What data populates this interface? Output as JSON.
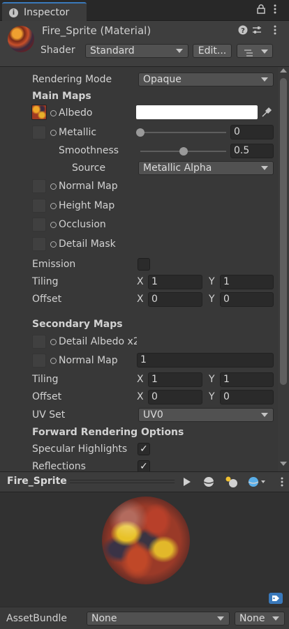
{
  "tab": {
    "label": "Inspector",
    "info_icon": "info-icon",
    "lock_icon": "lock-icon",
    "menu_icon": "kebab-menu-icon"
  },
  "header": {
    "title": "Fire_Sprite (Material)",
    "shader_label": "Shader",
    "shader_value": "Standard",
    "edit_label": "Edit...",
    "icons": [
      "help-icon",
      "settings-sliders-icon",
      "kebab-menu-icon",
      "list-icon"
    ]
  },
  "props": {
    "rendering_mode_label": "Rendering Mode",
    "rendering_mode_value": "Opaque",
    "main_maps": "Main Maps",
    "albedo": "Albedo",
    "metallic": "Metallic",
    "metallic_value": "0",
    "metallic_level": 0,
    "smoothness": "Smoothness",
    "smoothness_value": "0.5",
    "smoothness_level": 0.5,
    "source_label": "Source",
    "source_value": "Metallic Alpha",
    "normal_map": "Normal Map",
    "height_map": "Height Map",
    "occlusion": "Occlusion",
    "detail_mask": "Detail Mask",
    "emission": "Emission",
    "tiling": "Tiling",
    "offset": "Offset",
    "x": "X",
    "y": "Y",
    "tiling_x": "1",
    "tiling_y": "1",
    "offset_x": "0",
    "offset_y": "0",
    "secondary_maps": "Secondary Maps",
    "detail_albedo": "Detail Albedo x2",
    "sec_normal_map": "Normal Map",
    "sec_normal_value": "1",
    "sec_tiling_x": "1",
    "sec_tiling_y": "1",
    "sec_offset_x": "0",
    "sec_offset_y": "0",
    "uv_set_label": "UV Set",
    "uv_set_value": "UV0",
    "forward_options": "Forward Rendering Options",
    "specular_highlights": "Specular Highlights",
    "reflections": "Reflections",
    "checkmark": "✓"
  },
  "preview": {
    "title": "Fire_Sprite",
    "icons": [
      "play-icon",
      "sphere-shape-icon",
      "light-icon",
      "sphere-dropdown-icon",
      "kebab-menu-icon"
    ]
  },
  "assetbundle": {
    "label": "AssetBundle",
    "name_value": "None",
    "variant_value": "None"
  },
  "colors": {
    "accent": "#3a79bb",
    "panel": "#383838",
    "field": "#2a2a2a"
  }
}
